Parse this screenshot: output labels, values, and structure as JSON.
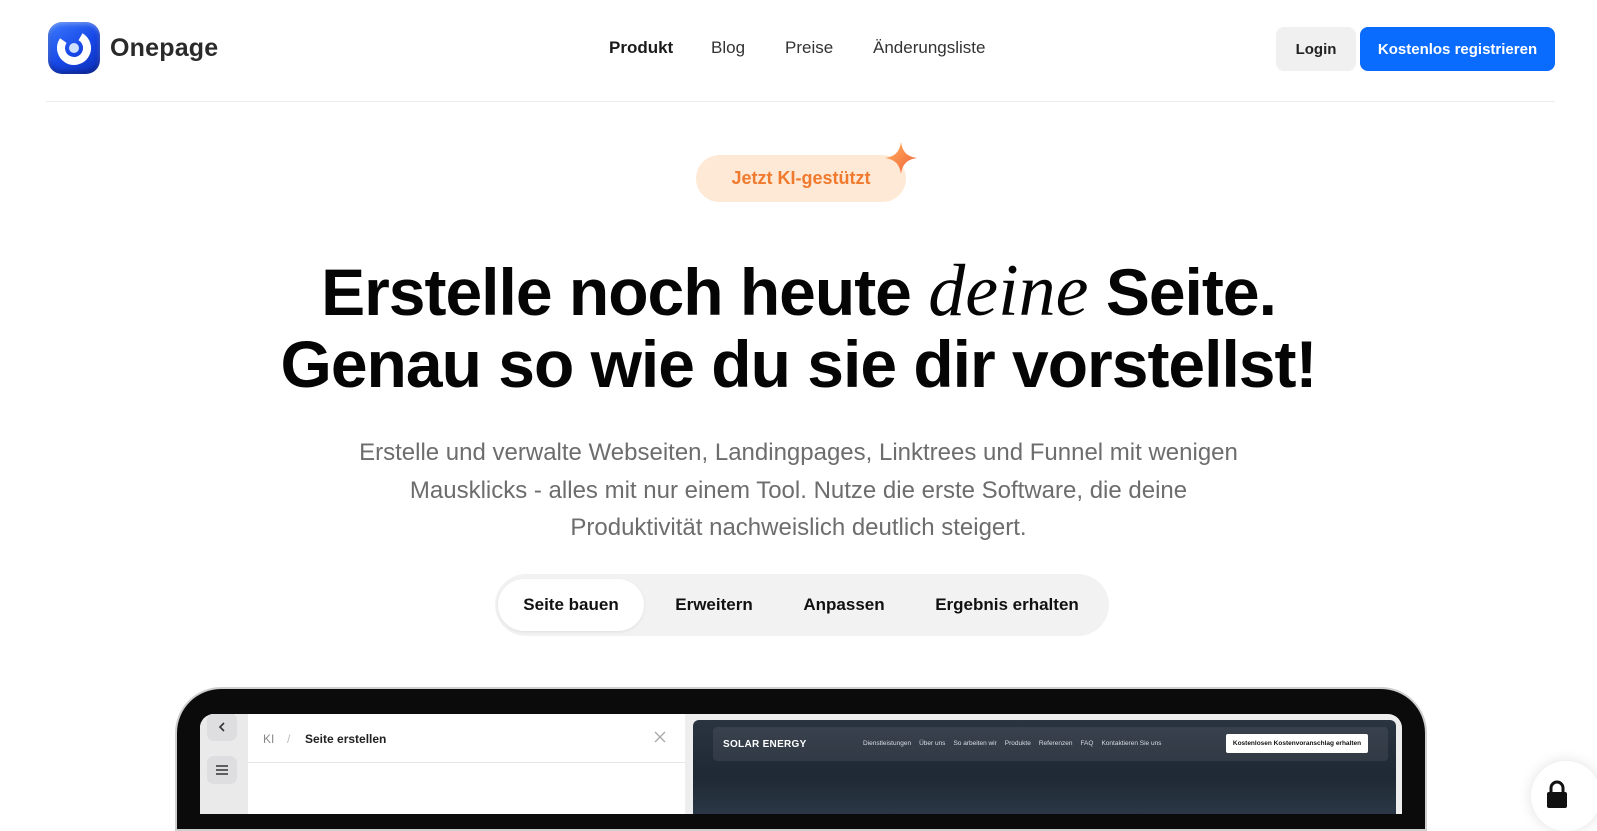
{
  "brand": {
    "name": "Onepage",
    "logo_icon": "onepage-logo-icon",
    "logo_color": "#1747e6"
  },
  "nav": {
    "items": [
      {
        "label": "Produkt",
        "active": true
      },
      {
        "label": "Blog",
        "active": false
      },
      {
        "label": "Preise",
        "active": false
      },
      {
        "label": "Änderungsliste",
        "active": false
      }
    ],
    "login_label": "Login",
    "register_label": "Kostenlos registrieren",
    "accent_color": "#0a6cff"
  },
  "hero": {
    "badge_label": "Jetzt KI-gestützt",
    "badge_icon": "sparkle-icon",
    "headline_part1": "Erstelle noch heute ",
    "headline_italic": "deine",
    "headline_part2": " Seite.",
    "headline_line2": "Genau so wie du sie dir vorstellst!",
    "subtitle": "Erstelle und verwalte Webseiten, Landingpages, Linktrees und Funnel mit wenigen Mausklicks - alles mit nur einem Tool. Nutze die erste Software, die deine Produktivität nachweislich deutlich steigert.",
    "tabs": [
      {
        "label": "Seite bauen",
        "active": true
      },
      {
        "label": "Erweitern",
        "active": false
      },
      {
        "label": "Anpassen",
        "active": false
      },
      {
        "label": "Ergebnis erhalten",
        "active": false
      }
    ]
  },
  "editor": {
    "crumb_root": "KI",
    "crumb_separator": "/",
    "crumb_title": "Seite erstellen",
    "close_icon": "close-icon",
    "back_icon": "chevron-left-icon",
    "menu_icon": "hamburger-menu-icon"
  },
  "preview": {
    "brand": "SOLAR ENERGY",
    "links": [
      "Dienstleistungen",
      "Über uns",
      "So arbeiten wir",
      "Produkte",
      "Referenzen",
      "FAQ",
      "Kontaktieren Sie uns"
    ],
    "cta": "Kostenlosen Kostenvoranschlag erhalten"
  },
  "floating": {
    "icon": "lock-icon"
  }
}
